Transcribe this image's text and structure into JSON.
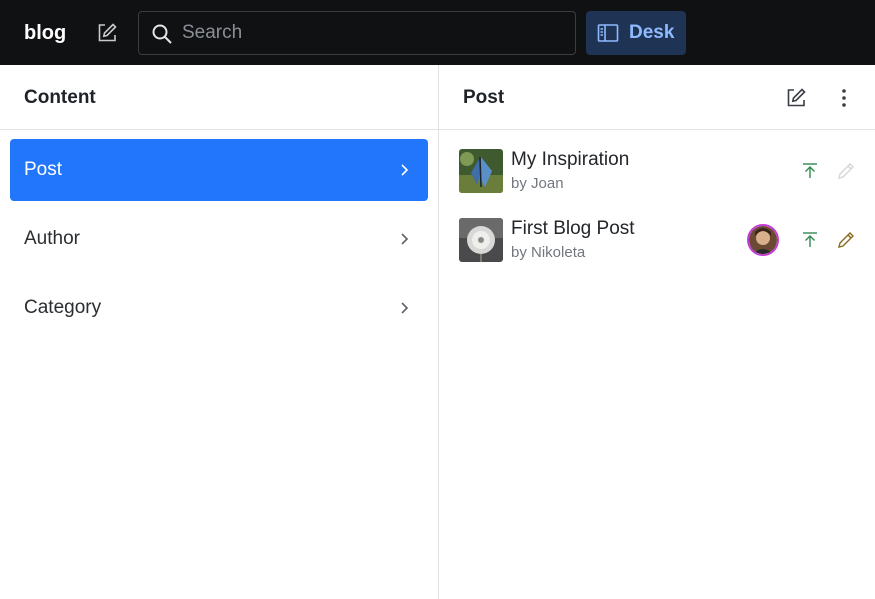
{
  "topbar": {
    "brand": "blog",
    "compose_icon": "compose-icon",
    "search": {
      "placeholder": "Search",
      "value": ""
    },
    "desk_label": "Desk",
    "colors": {
      "background": "#101112",
      "desk_bg": "#1f3454",
      "desk_text": "#8fbaff"
    }
  },
  "content_pane": {
    "title": "Content",
    "items": [
      {
        "label": "Post",
        "active": true
      },
      {
        "label": "Author",
        "active": false
      },
      {
        "label": "Category",
        "active": false
      }
    ],
    "accent": "#2276fc"
  },
  "post_pane": {
    "title": "Post",
    "posts": [
      {
        "title": "My Inspiration",
        "subtitle": "by Joan",
        "has_avatar": false,
        "publish_icon": "publish-icon",
        "edit_icon": "edit-pencil-icon",
        "edit_enabled": false
      },
      {
        "title": "First Blog Post",
        "subtitle": "by Nikoleta",
        "has_avatar": true,
        "publish_icon": "publish-icon",
        "edit_icon": "edit-pencil-icon",
        "edit_enabled": true
      }
    ]
  }
}
